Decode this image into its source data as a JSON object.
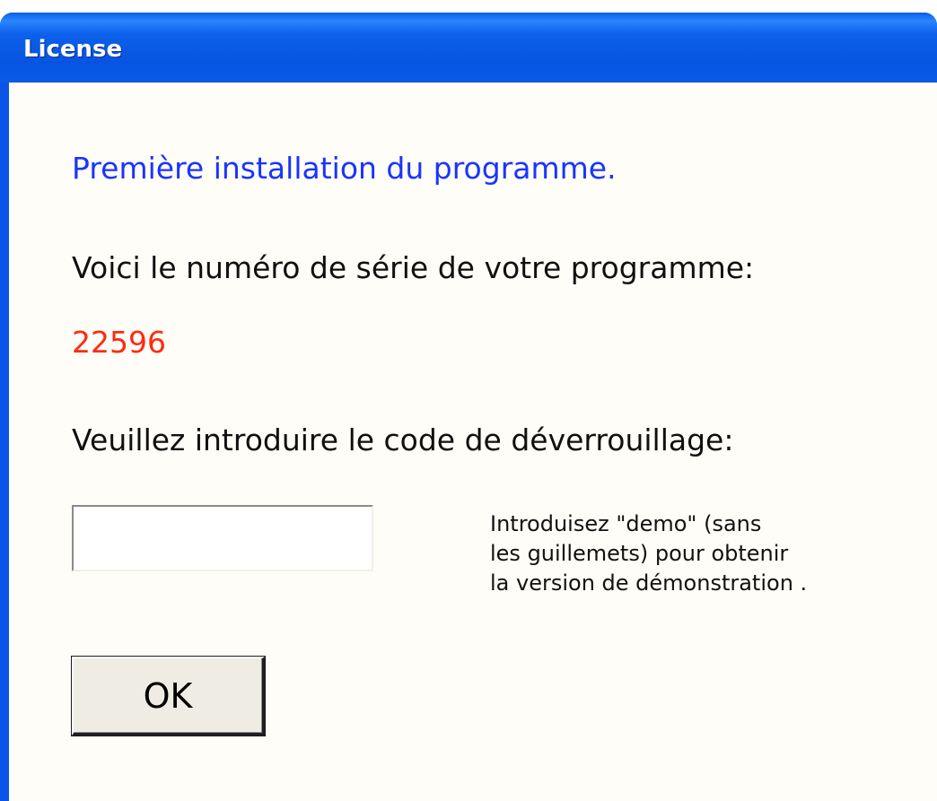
{
  "window": {
    "title": "License"
  },
  "content": {
    "heading": "Première installation du programme.",
    "serial_label": "Voici le  numéro de série de votre programme:",
    "serial_number": "22596",
    "unlock_label": "Veuillez introduire le code de déverrouillage:",
    "unlock_input": {
      "value": "",
      "placeholder": ""
    },
    "hint_lines": [
      "Introduisez \"demo\" (sans",
      "les guillemets) pour obtenir",
      "la version de démonstration ."
    ],
    "ok_label": "OK"
  },
  "colors": {
    "titlebar": "#0a55e8",
    "background": "#fffdf7",
    "heading": "#1a34ff",
    "serial": "#ff2a10",
    "text": "#101010"
  }
}
